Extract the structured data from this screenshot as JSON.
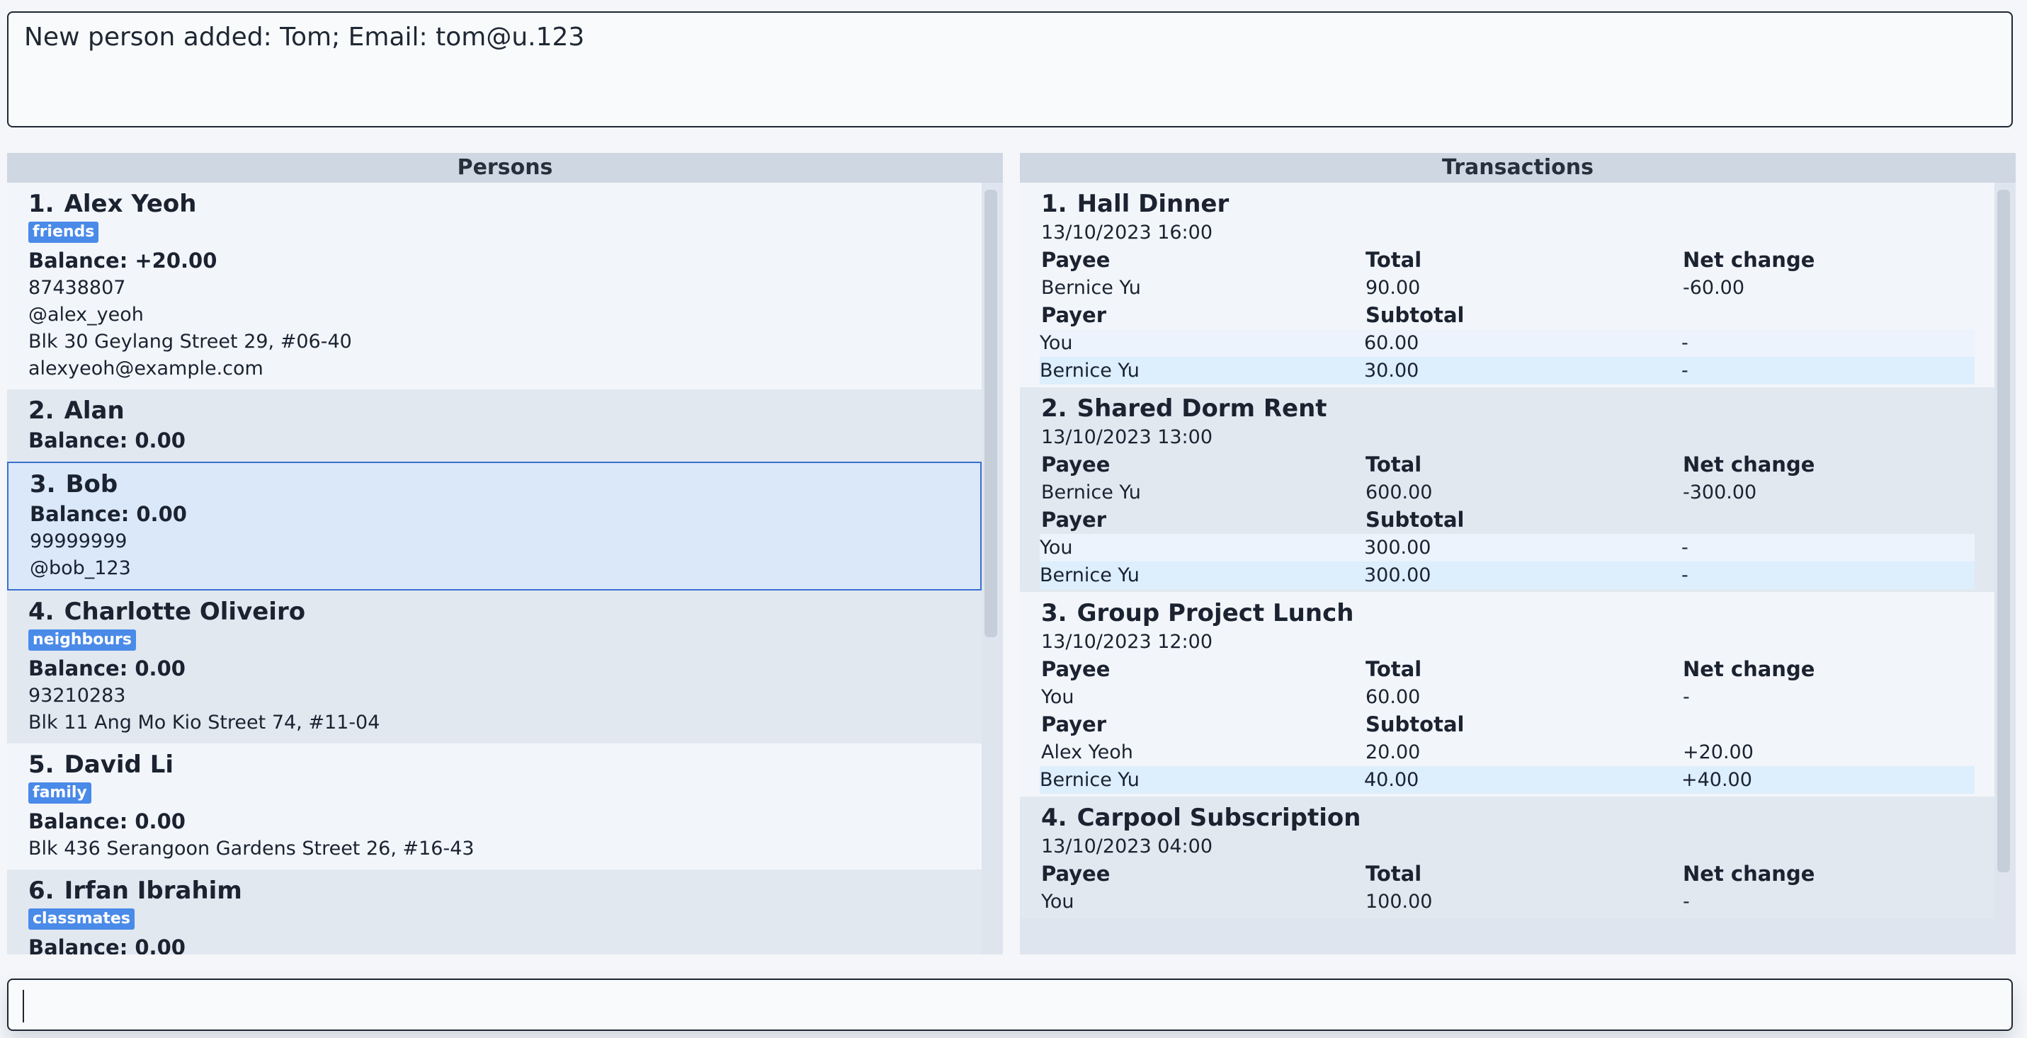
{
  "result_display": {
    "text": "New person added: Tom; Email: tom@u.123"
  },
  "persons_panel": {
    "title": "Persons",
    "items": [
      {
        "index": "1.",
        "name": "Alex Yeoh",
        "tag": "friends",
        "balance": "Balance: +20.00",
        "phone": "87438807",
        "telegram": "@alex_yeoh",
        "address": "Blk 30 Geylang Street 29, #06-40",
        "email": "alexyeoh@example.com"
      },
      {
        "index": "2.",
        "name": "Alan",
        "balance": "Balance: 0.00"
      },
      {
        "index": "3.",
        "name": "Bob",
        "balance": "Balance: 0.00",
        "phone": "99999999",
        "telegram": "@bob_123"
      },
      {
        "index": "4.",
        "name": "Charlotte Oliveiro",
        "tag": "neighbours",
        "balance": "Balance: 0.00",
        "phone": "93210283",
        "address": "Blk 11 Ang Mo Kio Street 74, #11-04"
      },
      {
        "index": "5.",
        "name": "David Li",
        "tag": "family",
        "balance": "Balance: 0.00",
        "address": "Blk 436 Serangoon Gardens Street 26, #16-43"
      },
      {
        "index": "6.",
        "name": "Irfan Ibrahim",
        "tag": "classmates",
        "balance": "Balance: 0.00"
      }
    ]
  },
  "transactions_panel": {
    "title": "Transactions",
    "labels": {
      "payee": "Payee",
      "total": "Total",
      "net_change": "Net change",
      "payer": "Payer",
      "subtotal": "Subtotal"
    },
    "items": [
      {
        "index": "1.",
        "title": "Hall Dinner",
        "datetime": "13/10/2023 16:00",
        "payee": {
          "name": "Bernice Yu",
          "total": "90.00",
          "net": "-60.00"
        },
        "payers": [
          {
            "name": "You",
            "subtotal": "60.00",
            "net": "-"
          },
          {
            "name": "Bernice Yu",
            "subtotal": "30.00",
            "net": "-"
          }
        ]
      },
      {
        "index": "2.",
        "title": "Shared Dorm Rent",
        "datetime": "13/10/2023 13:00",
        "payee": {
          "name": "Bernice Yu",
          "total": "600.00",
          "net": "-300.00"
        },
        "payers": [
          {
            "name": "You",
            "subtotal": "300.00",
            "net": "-"
          },
          {
            "name": "Bernice Yu",
            "subtotal": "300.00",
            "net": "-"
          }
        ]
      },
      {
        "index": "3.",
        "title": "Group Project Lunch",
        "datetime": "13/10/2023 12:00",
        "payee": {
          "name": "You",
          "total": "60.00",
          "net": "-"
        },
        "payers": [
          {
            "name": "Alex Yeoh",
            "subtotal": "20.00",
            "net": "+20.00"
          },
          {
            "name": "Bernice Yu",
            "subtotal": "40.00",
            "net": "+40.00"
          }
        ]
      },
      {
        "index": "4.",
        "title": "Carpool Subscription",
        "datetime": "13/10/2023 04:00",
        "payee": {
          "name": "You",
          "total": "100.00",
          "net": "-"
        }
      }
    ]
  },
  "command_box": {
    "value": "",
    "placeholder": ""
  },
  "colors": {
    "tag_bg": "#4a8ae8",
    "selected_border": "#3a6fcf",
    "selected_bg": "#dae8fa",
    "header_bg": "#cfd7e3"
  }
}
